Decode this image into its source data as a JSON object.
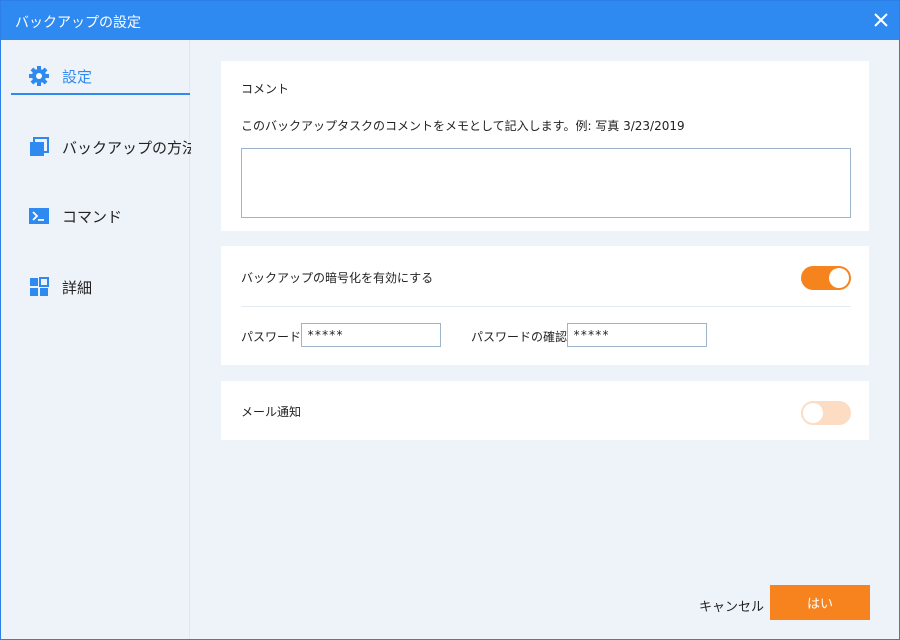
{
  "window": {
    "title": "バックアップの設定"
  },
  "sidebar": {
    "items": [
      {
        "label": "設定",
        "icon": "gear-icon",
        "active": true
      },
      {
        "label": "バックアップの方法",
        "icon": "copy-icon",
        "active": false
      },
      {
        "label": "コマンド",
        "icon": "terminal-icon",
        "active": false
      },
      {
        "label": "詳細",
        "icon": "grid-icon",
        "active": false
      }
    ]
  },
  "comment": {
    "heading": "コメント",
    "description": "このバックアップタスクのコメントをメモとして記入します。例: 写真 3/23/2019",
    "value": ""
  },
  "encryption": {
    "label": "バックアップの暗号化を有効にする",
    "enabled": true,
    "password_label": "パスワード",
    "password_value": "*****",
    "confirm_label": "パスワードの確認",
    "confirm_value": "*****"
  },
  "email": {
    "label": "メール通知",
    "enabled": false
  },
  "footer": {
    "cancel_label": "キャンセル",
    "ok_label": "はい"
  },
  "colors": {
    "titlebar": "#2e8af0",
    "accent_orange": "#f5841f",
    "toggle_off": "#fcdcc3",
    "icon_blue": "#2e8af0"
  }
}
